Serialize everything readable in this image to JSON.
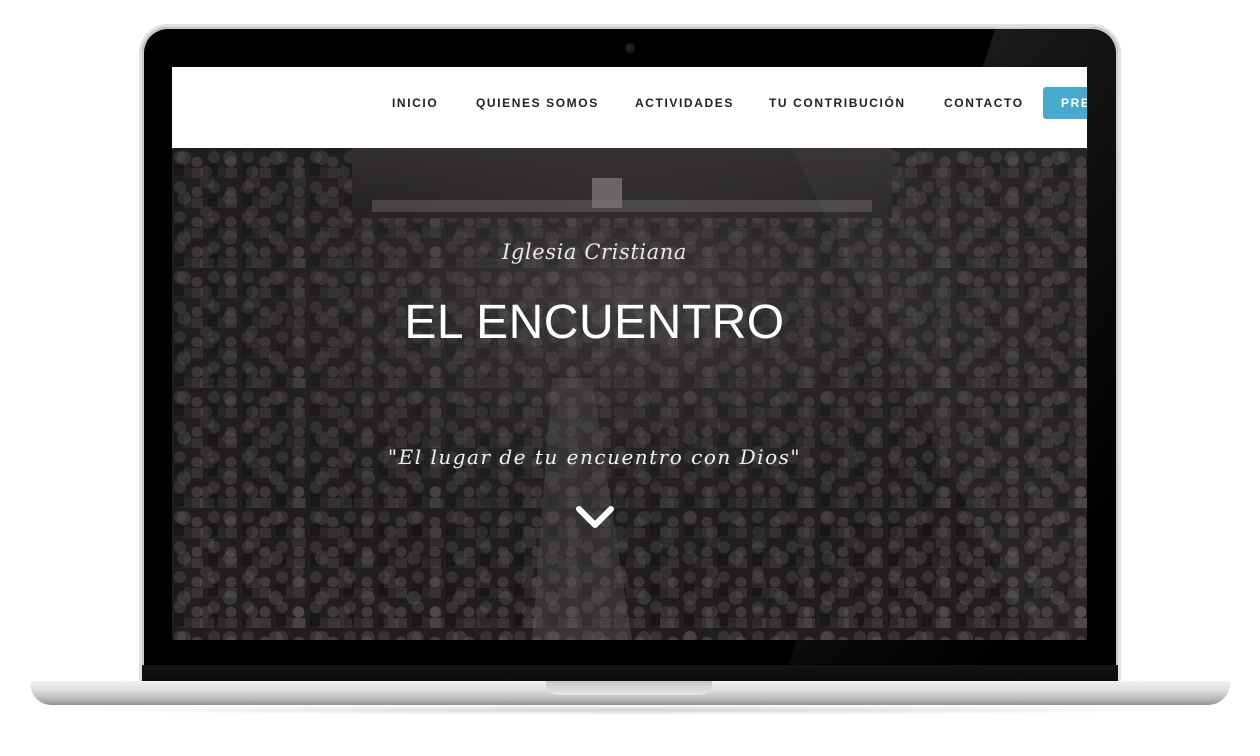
{
  "nav": {
    "items": [
      {
        "label": "INICIO"
      },
      {
        "label": "QUIENES SOMOS"
      },
      {
        "label": "ACTIVIDADES"
      },
      {
        "label": "TU CONTRIBUCIÓN"
      },
      {
        "label": "CONTACTO"
      }
    ],
    "cta_label": "PRE"
  },
  "hero": {
    "subtitle": "Iglesia Cristiana",
    "title": "EL ENCUENTRO",
    "tagline": "\"El lugar de tu encuentro con Dios\"",
    "scroll_icon": "chevron-down-icon"
  },
  "colors": {
    "accent": "#47a9cc",
    "nav_background": "#ffffff",
    "nav_text": "#222222",
    "hero_text": "#ffffff"
  }
}
